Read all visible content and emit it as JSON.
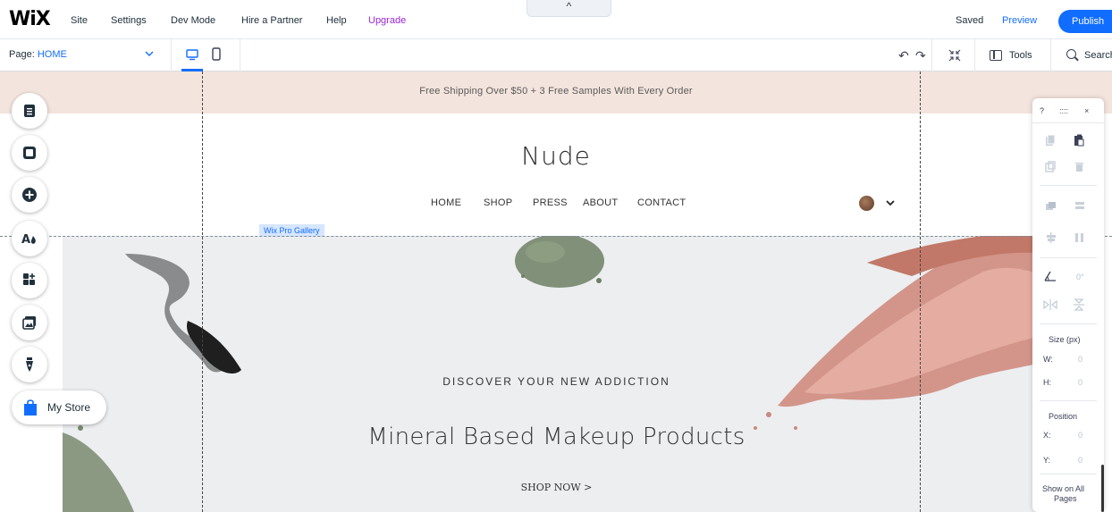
{
  "topbar": {
    "logo": "WiX",
    "menu": [
      {
        "id": "site",
        "label": "Site"
      },
      {
        "id": "settings",
        "label": "Settings"
      },
      {
        "id": "dev-mode",
        "label": "Dev Mode"
      },
      {
        "id": "hire-partner",
        "label": "Hire a Partner"
      },
      {
        "id": "help",
        "label": "Help"
      },
      {
        "id": "upgrade",
        "label": "Upgrade"
      }
    ],
    "collapse_glyph": "^",
    "status": "Saved",
    "preview_label": "Preview",
    "publish_label": "Publish",
    "colors": {
      "accent": "#116dff",
      "upgrade": "#9a27d5"
    }
  },
  "toolbar": {
    "page_prefix": "Page:",
    "page_value": "HOME",
    "page_chevron": "chevron-down-icon",
    "device_icons": [
      "desktop-icon",
      "mobile-icon"
    ],
    "active_device": "desktop",
    "undo_glyph": "↶",
    "redo_glyph": "↷",
    "zoom_glyph": "⤡",
    "tools_label": "Tools",
    "search_label": "Search"
  },
  "site": {
    "promo": "Free Shipping Over $50 + 3 Free Samples With Every Order",
    "title": "Nude",
    "nav": [
      "HOME",
      "SHOP",
      "PRESS",
      "ABOUT",
      "CONTACT"
    ],
    "gallery_tag": "Wix Pro Gallery",
    "hero": {
      "kicker": "DISCOVER YOUR NEW ADDICTION",
      "headline": "Mineral Based Makeup Products",
      "cta": "SHOP NOW >"
    },
    "colors": {
      "promo_bg": "#f3e4dd",
      "hero_bg": "#eceef0"
    }
  },
  "left_rail": {
    "buttons": [
      "menus-pages-icon",
      "background-icon",
      "add-icon",
      "theme-design-icon",
      "app-market-icon",
      "media-icon",
      "blog-pen-icon"
    ],
    "store_label": "My Store",
    "store_icon": "shopping-bag-icon"
  },
  "inspector": {
    "header_help": "?",
    "header_drag": "::::",
    "header_close": "×",
    "rotation_value": "0°",
    "size_title": "Size (px)",
    "w_label": "W:",
    "w_value": "0",
    "h_label": "H:",
    "h_value": "0",
    "position_title": "Position",
    "x_label": "X:",
    "x_value": "0",
    "y_label": "Y:",
    "y_value": "0",
    "show_on_all_line1": "Show on All",
    "show_on_all_line2": "Pages"
  }
}
